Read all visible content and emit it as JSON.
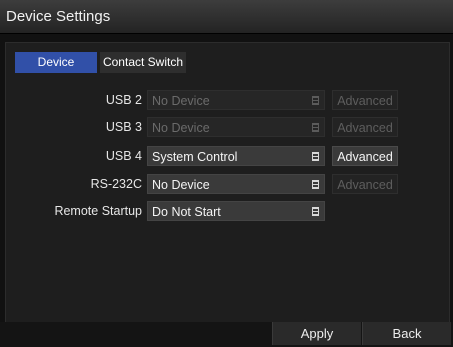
{
  "window": {
    "title": "Device Settings"
  },
  "tabs": [
    {
      "label": "Device",
      "active": true
    },
    {
      "label": "Contact Switch",
      "active": false
    }
  ],
  "rows": [
    {
      "label": "USB 2",
      "value": "No Device",
      "enabled": false,
      "advanced": "Advanced",
      "advanced_enabled": false
    },
    {
      "label": "USB 3",
      "value": "No Device",
      "enabled": false,
      "advanced": "Advanced",
      "advanced_enabled": false
    },
    {
      "label": "USB 4",
      "value": "System Control",
      "enabled": true,
      "advanced": "Advanced",
      "advanced_enabled": true
    },
    {
      "label": "RS-232C",
      "value": "No Device",
      "enabled": true,
      "advanced": "Advanced",
      "advanced_enabled": false
    },
    {
      "label": "Remote Startup",
      "value": "Do Not Start",
      "enabled": true
    }
  ],
  "buttons": {
    "apply": "Apply",
    "back": "Back"
  },
  "colors": {
    "accent": "#3150a8"
  }
}
